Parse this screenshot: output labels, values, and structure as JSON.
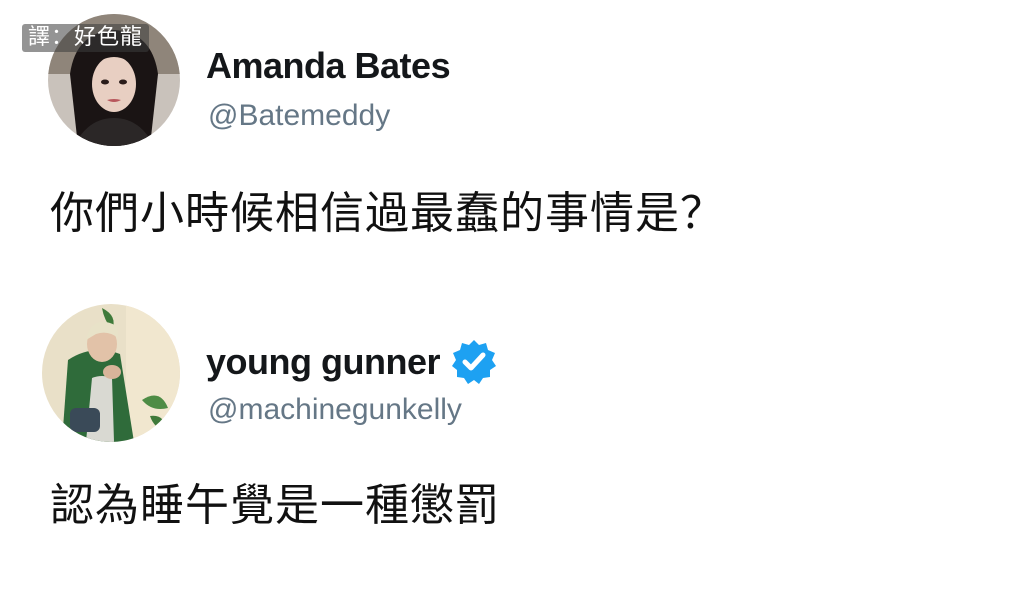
{
  "watermark": {
    "text": "譯：好色龍"
  },
  "tweets": [
    {
      "display_name": "Amanda Bates",
      "handle": "@Batemeddy",
      "verified": false,
      "text": "你們小時候相信過最蠢的事情是？",
      "avatar": "woman-dark-hair-portrait"
    },
    {
      "display_name": "young gunner",
      "handle": "@machinegunkelly",
      "verified": true,
      "verified_icon": "verified-badge-icon",
      "verified_color": "#1da1f2",
      "text": "認為睡午覺是一種懲罰",
      "avatar": "man-green-jacket-portrait"
    }
  ],
  "colors": {
    "name": "#14171a",
    "handle": "#657786",
    "text": "#111111",
    "background": "#ffffff"
  }
}
